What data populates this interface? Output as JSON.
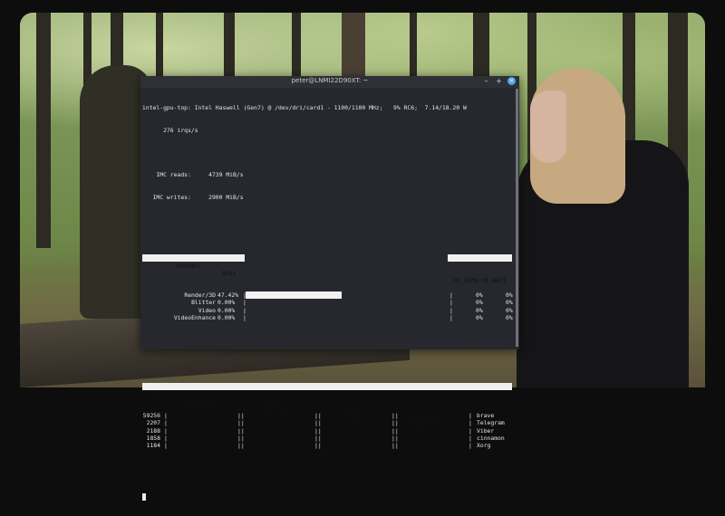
{
  "window": {
    "title": "peter@LNMI22D90XT: ~",
    "minimize_label": "–",
    "maximize_label": "+",
    "close_label": "×"
  },
  "gpu_top": {
    "header_line1": "intel-gpu-top: Intel Haswell (Gen7) @ /dev/dri/card1 - 1100/1100 MHz;   9% RC6;  7.14/18.20 W",
    "header_line2": "      276 irqs/s",
    "imc_reads": "    IMC reads:     4739 MiB/s",
    "imc_writes": "   IMC writes:     2900 MiB/s",
    "engines_header": {
      "engines": "ENGINES",
      "busy": "BUSY",
      "mi_cols": "MI_SEMA MI_WAIT"
    },
    "engines": [
      {
        "name": "Render/3D",
        "busy": "47.42%",
        "busy_fraction": 0.4742,
        "sema": "0%",
        "wait": "0%"
      },
      {
        "name": "Blitter",
        "busy": "0.00%",
        "busy_fraction": 0,
        "sema": "0%",
        "wait": "0%"
      },
      {
        "name": "Video",
        "busy": "0.00%",
        "busy_fraction": 0,
        "sema": "0%",
        "wait": "0%"
      },
      {
        "name": "VideoEnhance",
        "busy": "0.00%",
        "busy_fraction": 0,
        "sema": "0%",
        "wait": "0%"
      }
    ],
    "clients_header": {
      "pid": "PID",
      "render": "Render/3D",
      "blitter": "Blitter",
      "video": "Video",
      "enhance": "VideoEnhance",
      "name": "NAME"
    },
    "clients": [
      {
        "pid": "59256",
        "name": "brave"
      },
      {
        "pid": "2207",
        "name": "Telegram"
      },
      {
        "pid": "2188",
        "name": "Viber"
      },
      {
        "pid": "1858",
        "name": "cinnamon"
      },
      {
        "pid": "1184",
        "name": "Xorg"
      }
    ]
  }
}
